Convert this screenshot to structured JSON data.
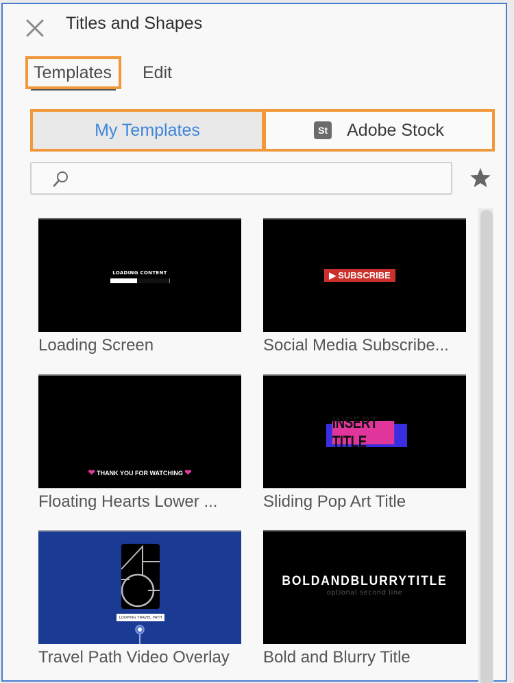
{
  "panel": {
    "title": "Titles and Shapes",
    "close_icon": "close-icon"
  },
  "tabs": [
    {
      "label": "Templates",
      "active": true
    },
    {
      "label": "Edit",
      "active": false
    }
  ],
  "segments": {
    "my_templates": {
      "label": "My Templates",
      "active": true
    },
    "adobe_stock": {
      "label": "Adobe Stock",
      "badge": "St",
      "active": false
    }
  },
  "search": {
    "value": "",
    "placeholder": "",
    "icon": "search-icon"
  },
  "favorites_icon": "star-icon",
  "colors": {
    "accent_blue": "#3f86dc",
    "highlight_orange": "#f0983a",
    "panel_border": "#4a7bd0"
  },
  "templates": [
    {
      "label": "Loading Screen",
      "preview": {
        "text": "LOADING CONTENT",
        "progress": 0.45
      }
    },
    {
      "label": "Social Media Subscribe...",
      "preview": {
        "text": "SUBSCRIBE",
        "icon": "play-icon"
      }
    },
    {
      "label": "Floating Hearts Lower ...",
      "preview": {
        "text": "THANK YOU FOR WATCHING",
        "icon": "heart-icon"
      }
    },
    {
      "label": "Sliding Pop Art Title",
      "preview": {
        "text": "INSERT TITLE"
      }
    },
    {
      "label": "Travel Path Video Overlay",
      "preview": {
        "text": "LOOPING TRAVEL PATH"
      }
    },
    {
      "label": "Bold and Blurry Title",
      "preview": {
        "text": "BOLDANDBLURRYTITLE",
        "subtext": "optional second line"
      }
    }
  ]
}
